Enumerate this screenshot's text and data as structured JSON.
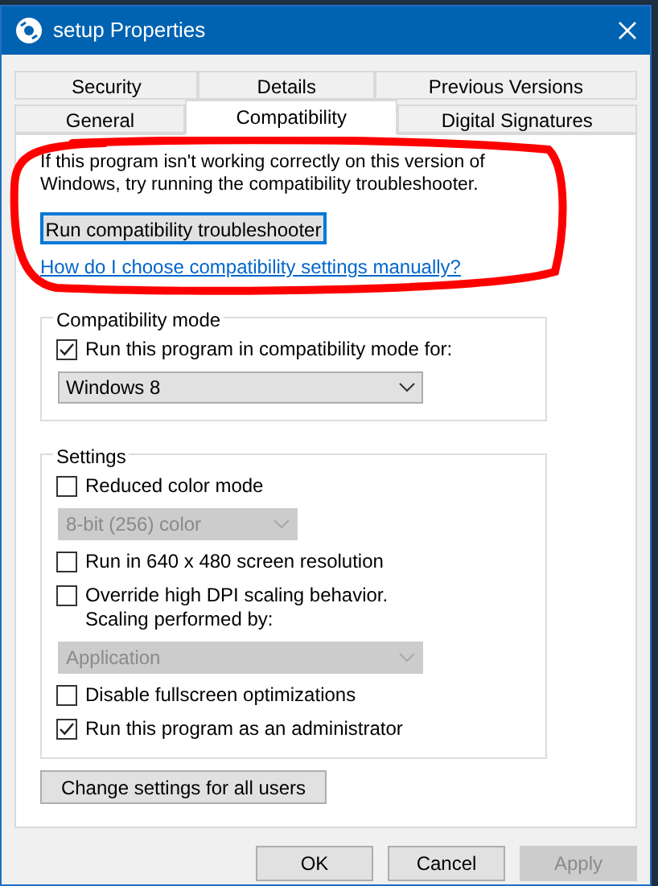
{
  "window": {
    "title": "setup Properties"
  },
  "tab_rows": [
    [
      {
        "label": "Security",
        "selected": false
      },
      {
        "label": "Details",
        "selected": false
      },
      {
        "label": "Previous Versions",
        "selected": false
      }
    ],
    [
      {
        "label": "General",
        "selected": false
      },
      {
        "label": "Compatibility",
        "selected": true
      },
      {
        "label": "Digital Signatures",
        "selected": false
      }
    ]
  ],
  "intro": "If this program isn't working correctly on this version of Windows, try running the compatibility troubleshooter.",
  "troubleshoot_button": {
    "label": "Run compatibility troubleshooter",
    "focused": true
  },
  "help_link": "How do I choose compatibility settings manually?",
  "groups": [
    {
      "title": "Compatibility mode",
      "items": [
        {
          "kind": "checkbox",
          "label": "Run this program in compatibility mode for:",
          "checked": true
        },
        {
          "kind": "dropdown",
          "value": "Windows 8",
          "disabled": false
        }
      ]
    },
    {
      "title": "Settings",
      "items": [
        {
          "kind": "checkbox",
          "label": "Reduced color mode",
          "checked": false
        },
        {
          "kind": "dropdown",
          "value": "8-bit (256) color",
          "disabled": true
        },
        {
          "kind": "checkbox",
          "label": "Run in 640 x 480 screen resolution",
          "checked": false
        },
        {
          "kind": "checkbox",
          "label": "Override high DPI scaling behavior.\nScaling performed by:",
          "checked": false
        },
        {
          "kind": "dropdown",
          "value": "Application",
          "disabled": true
        },
        {
          "kind": "checkbox",
          "label": "Disable fullscreen optimizations",
          "checked": false
        },
        {
          "kind": "checkbox",
          "label": "Run this program as an administrator",
          "checked": true
        }
      ]
    }
  ],
  "all_users_button": "Change settings for all users",
  "buttons": [
    {
      "label": "OK",
      "disabled": false
    },
    {
      "label": "Cancel",
      "disabled": false
    },
    {
      "label": "Apply",
      "disabled": true
    }
  ],
  "annotation": {
    "kind": "red-circle"
  }
}
